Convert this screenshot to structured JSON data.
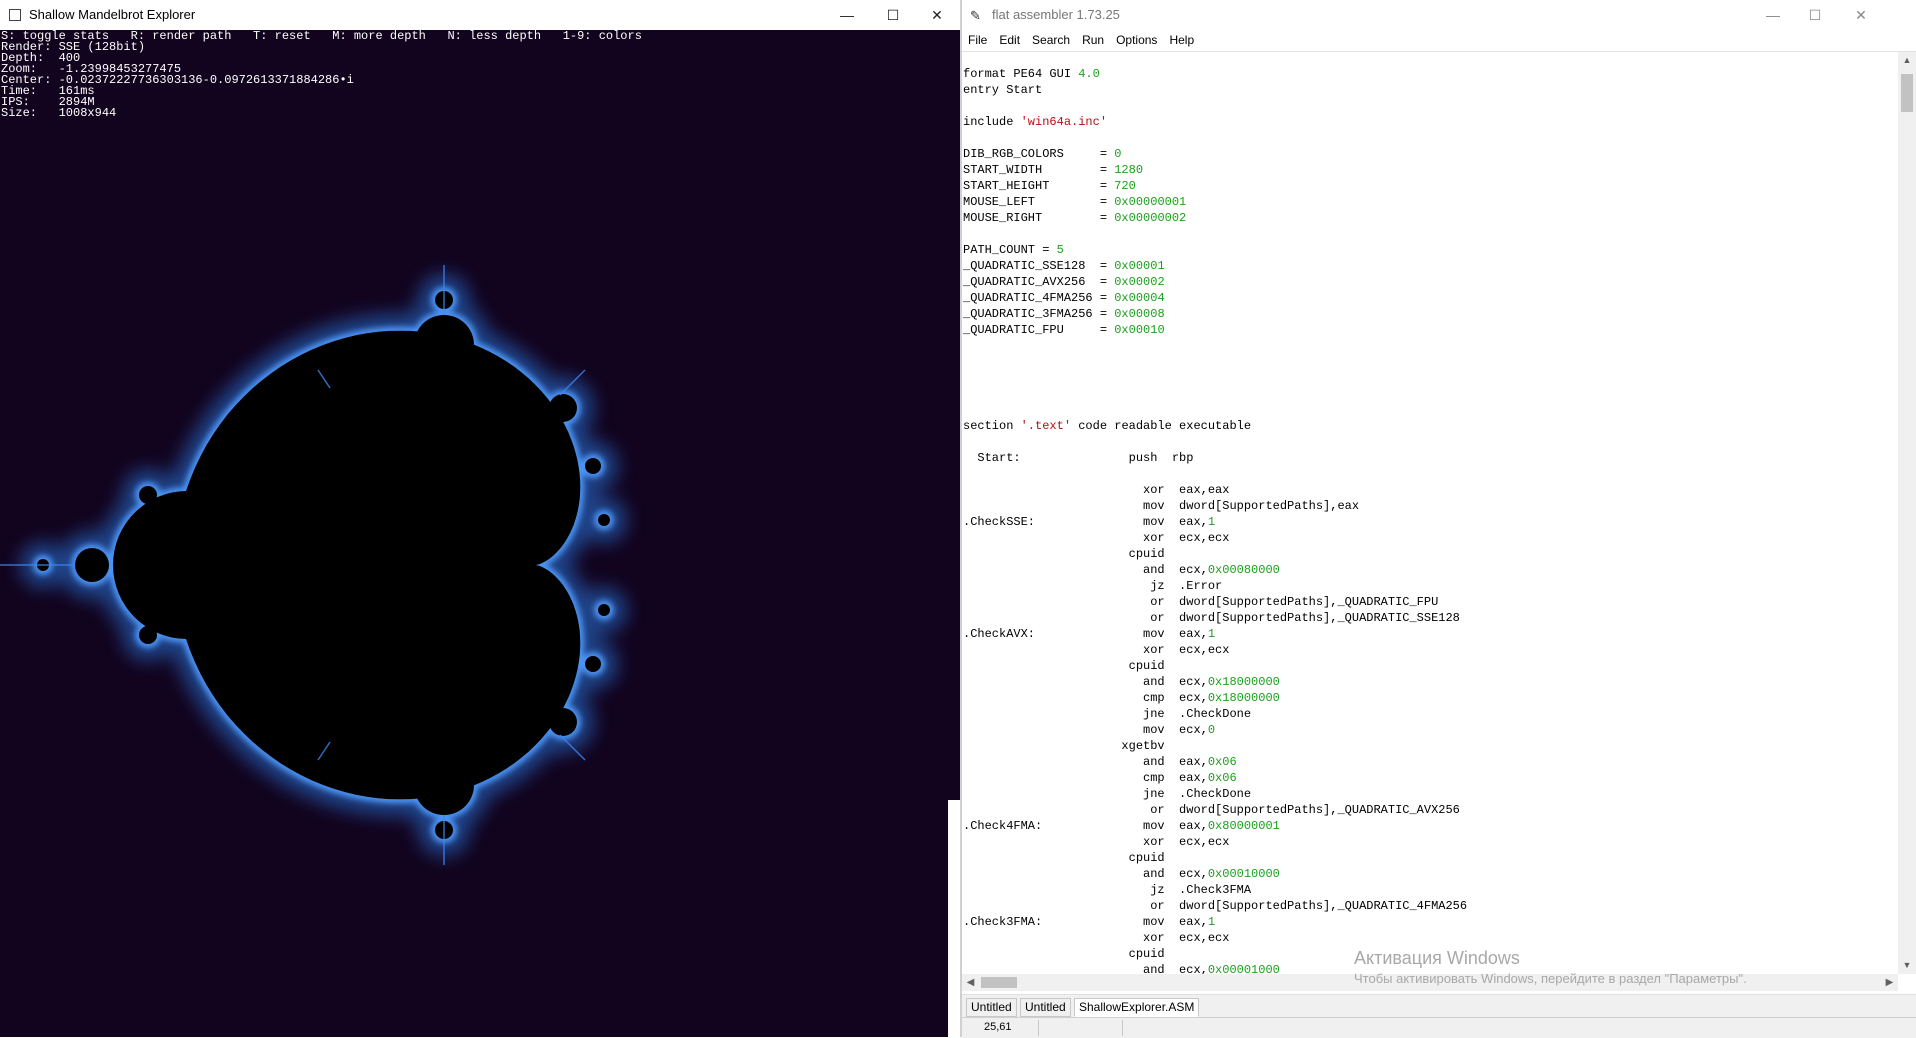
{
  "mandelbrot_window": {
    "title": "Shallow Mandelbrot Explorer",
    "controls": {
      "minimize": "—",
      "maximize": "☐",
      "close": "✕"
    },
    "stats_lines": [
      "S: toggle stats   R: render path   T: reset   M: more depth   N: less depth   1-9: colors",
      "Render: SSE (128bit)",
      "Depth:  400",
      "Zoom:   -1.23998453277475",
      "Center: -0.02372227736303136-0.0972613371884286•i",
      "Time:   161ms",
      "IPS:    2894M",
      "Size:   1008x944"
    ],
    "colors": {
      "background": "#12031e",
      "set": "#000000",
      "glow": "#2a78e0"
    }
  },
  "fasm_window": {
    "title": "flat assembler 1.73.25",
    "controls": {
      "minimize": "—",
      "maximize": "☐",
      "close": "✕"
    },
    "menu": [
      "File",
      "Edit",
      "Search",
      "Run",
      "Options",
      "Help"
    ],
    "code_lines": [
      "format PE64 GUI 4.0",
      "entry Start",
      "",
      "include 'win64a.inc'",
      "",
      "DIB_RGB_COLORS     = 0",
      "START_WIDTH        = 1280",
      "START_HEIGHT       = 720",
      "MOUSE_LEFT         = 0x00000001",
      "MOUSE_RIGHT        = 0x00000002",
      "",
      "PATH_COUNT = 5",
      "_QUADRATIC_SSE128  = 0x00001",
      "_QUADRATIC_AVX256  = 0x00002",
      "_QUADRATIC_4FMA256 = 0x00004",
      "_QUADRATIC_3FMA256 = 0x00008",
      "_QUADRATIC_FPU     = 0x00010",
      "",
      "",
      "",
      "",
      "",
      "section '.text' code readable executable",
      "",
      "  Start:               push  rbp",
      "",
      "                         xor  eax,eax",
      "                         mov  dword[SupportedPaths],eax",
      ".CheckSSE:               mov  eax,1",
      "                         xor  ecx,ecx",
      "                       cpuid",
      "                         and  ecx,0x00080000",
      "                          jz  .Error",
      "                          or  dword[SupportedPaths],_QUADRATIC_FPU",
      "                          or  dword[SupportedPaths],_QUADRATIC_SSE128",
      ".CheckAVX:               mov  eax,1",
      "                         xor  ecx,ecx",
      "                       cpuid",
      "                         and  ecx,0x18000000",
      "                         cmp  ecx,0x18000000",
      "                         jne  .CheckDone",
      "                         mov  ecx,0",
      "                      xgetbv",
      "                         and  eax,0x06",
      "                         cmp  eax,0x06",
      "                         jne  .CheckDone",
      "                          or  dword[SupportedPaths],_QUADRATIC_AVX256",
      ".Check4FMA:              mov  eax,0x80000001",
      "                         xor  ecx,ecx",
      "                       cpuid",
      "                         and  ecx,0x00010000",
      "                          jz  .Check3FMA",
      "                          or  dword[SupportedPaths],_QUADRATIC_4FMA256",
      ".Check3FMA:              mov  eax,1",
      "                         xor  ecx,ecx",
      "                       cpuid",
      "                         and  ecx,0x00001000"
    ],
    "tabs": [
      "Untitled",
      "Untitled",
      "ShallowExplorer.ASM"
    ],
    "active_tab": 2,
    "status_position": "25,61",
    "watermark": {
      "line1": "Активация Windows",
      "line2": "Чтобы активировать Windows, перейдите в раздел \"Параметры\"."
    },
    "colors": {
      "number": "#1e9e1e",
      "string": "#b01010"
    }
  }
}
